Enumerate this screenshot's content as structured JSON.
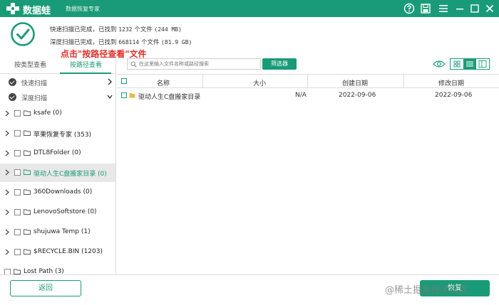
{
  "app": {
    "name": "数据蛙",
    "subtitle": "数据恢复专家"
  },
  "colors": {
    "accent": "#1a9b77",
    "annotation": "#e0302b"
  },
  "status": {
    "quick_prefix": "快速扫描已完成，已找到",
    "quick_count": "1232",
    "quick_middle": "个文件",
    "quick_size": "(244 MB)",
    "deep_prefix": "深度扫描已完成，已找到",
    "deep_count": "668114",
    "deep_middle": "个文件",
    "deep_size": "(81.9 GB)"
  },
  "annotation": "点击\"按路径查看\"文件",
  "sidebar": {
    "tabs": [
      {
        "label": "按类型查看"
      },
      {
        "label": "按路径查看"
      }
    ],
    "scan_modes": [
      {
        "label": "快速扫描"
      },
      {
        "label": "深度扫描"
      }
    ],
    "tree": [
      {
        "label": "ksafe (0)"
      },
      {
        "label": "苹果恢复专家 (353)"
      },
      {
        "label": "DTL8Folder (0)"
      },
      {
        "label": "驱动人生C盘搬家目录 (0)"
      },
      {
        "label": "360Downloads (0)"
      },
      {
        "label": "LenovoSoftstore (0)"
      },
      {
        "label": "shujuwa Temp (1)"
      },
      {
        "label": "$RECYCLE.BIN (1203)"
      },
      {
        "label": "Lost Path (3)"
      }
    ]
  },
  "toolbar": {
    "search_placeholder": "在这里输入文件名称或路径搜索",
    "filter_label": "筛选器"
  },
  "table": {
    "headers": {
      "name": "名称",
      "size": "大小",
      "created": "创建日期",
      "modified": "修改日期"
    },
    "rows": [
      {
        "name": "驱动人生C盘搬家目录",
        "size": "N/A",
        "created": "2022-09-06",
        "modified": "2022-09-06"
      }
    ]
  },
  "footer": {
    "back_label": "返回",
    "recover_label": "恢复",
    "watermark": "@稀土掘金技术社区"
  }
}
